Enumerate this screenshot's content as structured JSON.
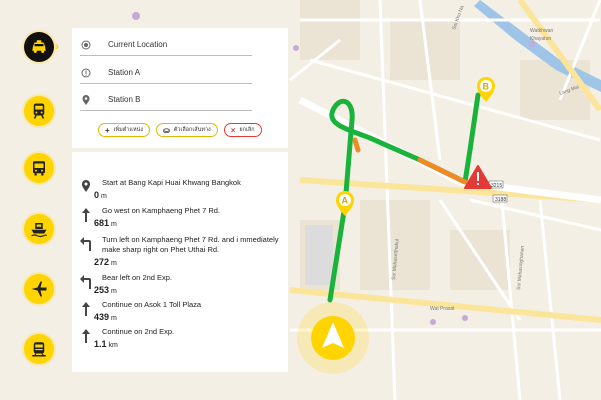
{
  "map": {
    "marker_a": "A",
    "marker_b": "B",
    "route_color": "#19b33b",
    "traffic_color": "#f08a24",
    "labels": {
      "soi_kho_na": "Soi Kho Na",
      "wat_khwan": "Watkhwan",
      "wat_khwan_sub": "Khayaton",
      "lang_mai": "Lang Mai",
      "soi_mahasethakul": "Soi Mahasetthakul",
      "soi_mahasinghanan": "Soi Mahasinghanan",
      "wat_prasat": "Wat Prasat",
      "road_num_1": "3188",
      "road_num_2": "3215"
    }
  },
  "modes": [
    {
      "name": "taxi",
      "icon": "taxi-icon",
      "active": true
    },
    {
      "name": "train",
      "icon": "train-icon"
    },
    {
      "name": "bus",
      "icon": "bus-icon"
    },
    {
      "name": "boat",
      "icon": "boat-icon"
    },
    {
      "name": "plane",
      "icon": "plane-icon"
    },
    {
      "name": "metro",
      "icon": "metro-icon"
    }
  ],
  "search": {
    "current_location": "Current Location",
    "station_a": "Station A",
    "station_b": "Station B",
    "add_label": "เพิ่มตำแหน่ง",
    "options_label": "ตัวเลือกเส้นทาง",
    "cancel_label": "ยกเลิก"
  },
  "steps": [
    {
      "icon": "location-pin-icon",
      "text": "Start at Bang Kapi Huai Khwang Bangkok",
      "value": "0",
      "unit": "m"
    },
    {
      "icon": "arrow-up-icon",
      "text": "Go west on Kamphaeng Phet 7 Rd.",
      "value": "681",
      "unit": "m"
    },
    {
      "icon": "turn-left-icon",
      "text": "Turn left on Kamphaeng Phet 7 Rd. and i mmediately make sharp right on Phet Uthai Rd.",
      "value": "272",
      "unit": "m"
    },
    {
      "icon": "bear-left-icon",
      "text": "Bear left on 2nd Exp.",
      "value": "253",
      "unit": "m"
    },
    {
      "icon": "arrow-up-icon",
      "text": "Continue on Asok 1 Toll Plaza",
      "value": "439",
      "unit": "m"
    },
    {
      "icon": "arrow-up-icon",
      "text": "Continue on 2nd Exp.",
      "value": "1.1",
      "unit": "km"
    }
  ],
  "colors": {
    "accent": "#ffd400",
    "cancel": "#e53935",
    "warning": "#e53935"
  }
}
